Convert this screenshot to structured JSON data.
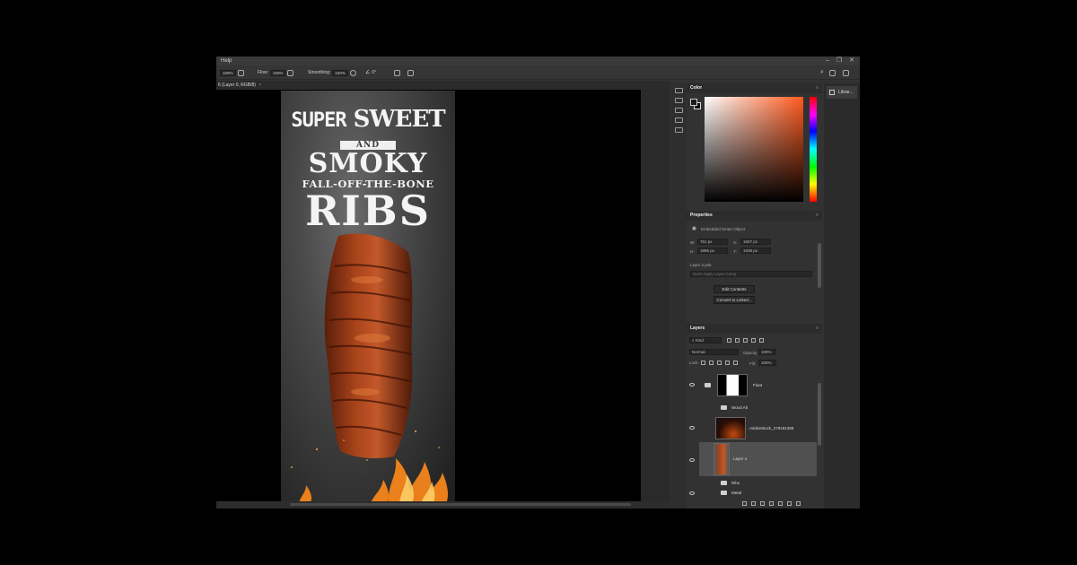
{
  "menubar": {
    "help": "Help",
    "window_controls": [
      "–",
      "❐",
      "✕"
    ]
  },
  "options_bar": {
    "size": "100%",
    "flow_label": "Flow:",
    "flow": "100%",
    "smoothing_label": "Smoothing:",
    "smoothing": "100%",
    "angle": "0°"
  },
  "document_tab": {
    "title": "6 (Layer 0, RGB/8)",
    "close": "×"
  },
  "artwork": {
    "line1a": "Super",
    "line1b": "Sweet",
    "and": "And",
    "line2": "Smoky",
    "line3": "Fall-off-the-bone",
    "line4": "Ribs"
  },
  "libraries": {
    "label": "Librar..."
  },
  "color_panel": {
    "title": "Color",
    "hue_color": "#ff5a1e"
  },
  "properties": {
    "title": "Properties",
    "object_type": "Embedded Smart Object",
    "w_label": "W:",
    "w": "751 px",
    "h_label": "H:",
    "h": "1866 px",
    "x_label": "X:",
    "x": "1607 px",
    "y_label": "Y:",
    "y": "1938 px",
    "filename": "Layer 4.psb",
    "comp_placeholder": "Don't Apply Layer Comp",
    "edit_contents": "Edit Contents",
    "convert_linked": "Convert to Linked..."
  },
  "layers": {
    "title": "Layers",
    "filter_kind": "Kind",
    "blend_mode": "Normal",
    "opacity_label": "Opacity:",
    "opacity": "100%",
    "lock_label": "Lock:",
    "fill_label": "Fill:",
    "fill": "100%",
    "items": [
      {
        "name": "Float"
      },
      {
        "name": "Wood Alt"
      },
      {
        "name": "AdobeStock_279191399"
      },
      {
        "name": "Layer 4"
      },
      {
        "name": "Ribs"
      },
      {
        "name": "Metal"
      }
    ]
  }
}
